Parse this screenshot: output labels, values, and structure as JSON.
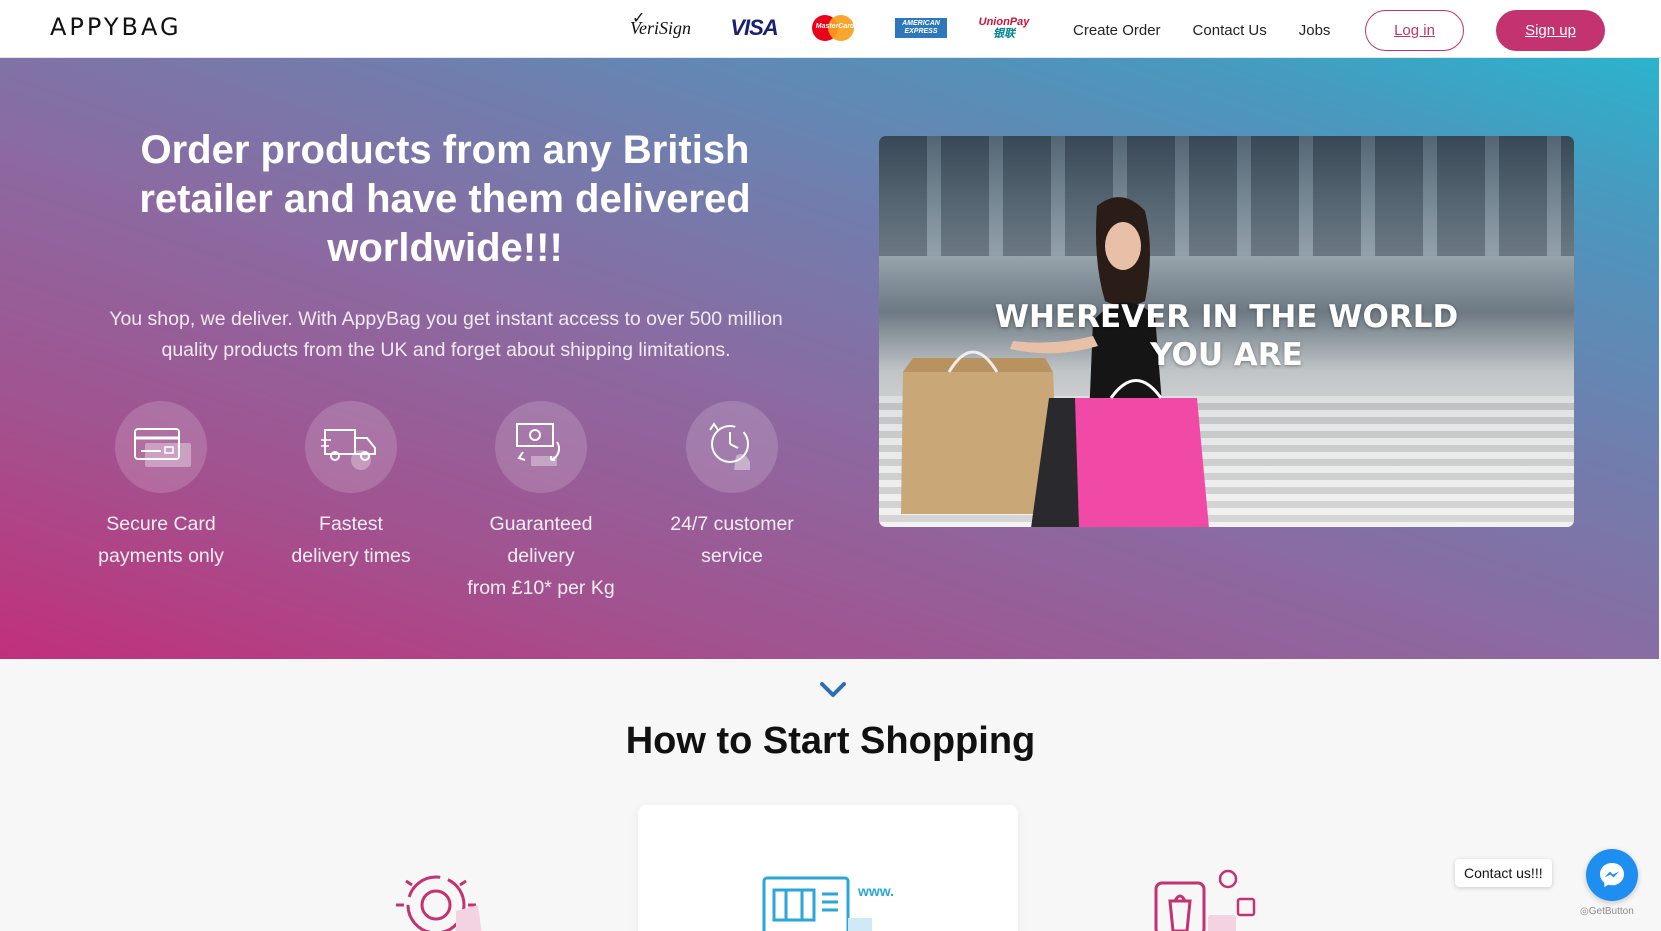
{
  "brand": {
    "logo_text": "APPYBAG"
  },
  "payment_logos": {
    "verisign": "VeriSign",
    "visa": "VISA",
    "mastercard": "MasterCard",
    "amex_line1": "AMERICAN",
    "amex_line2": "EXPRESS",
    "unionpay_line1": "UnionPay",
    "unionpay_line2": "银联"
  },
  "nav": {
    "links": [
      "Create Order",
      "Contact Us",
      "Jobs"
    ],
    "login_label": "Log in",
    "signup_label": "Sign up"
  },
  "hero": {
    "title": "Order products from any British retailer and have them delivered worldwide!!!",
    "subtitle": "You shop, we deliver. With AppyBag you get instant access to over 500 million quality products from the UK and forget about shipping limitations.",
    "features": [
      {
        "icon": "credit-card-icon",
        "lines": [
          "Secure Card",
          "payments only"
        ]
      },
      {
        "icon": "delivery-truck-icon",
        "lines": [
          "Fastest",
          "delivery times"
        ]
      },
      {
        "icon": "money-exchange-icon",
        "lines": [
          "Guaranteed",
          "delivery",
          "from £10* per Kg"
        ]
      },
      {
        "icon": "clock-support-icon",
        "lines": [
          "24/7 customer",
          "service"
        ]
      }
    ],
    "image_caption_line1": "WHEREVER IN THE WORLD",
    "image_caption_line2": "YOU ARE"
  },
  "how_to": {
    "title": "How to Start Shopping",
    "steps_icons": [
      "target-icon",
      "website-browser-icon",
      "mobile-social-icon"
    ],
    "www_label": "www."
  },
  "widget": {
    "contact_label": "Contact us!!!",
    "getbutton_label": "GetButton"
  },
  "colors": {
    "accent": "#c2336f",
    "gradient_start": "#c1307a",
    "gradient_end": "#2bb3cd",
    "chevron": "#2b6fb3",
    "messenger": "#1f8ef1"
  }
}
